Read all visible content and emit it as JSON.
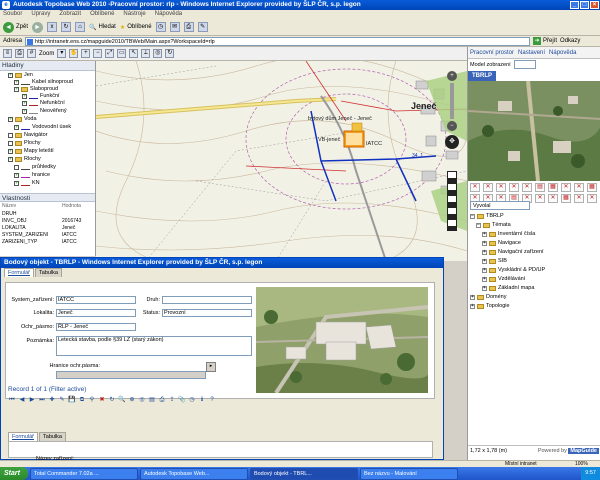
{
  "window": {
    "title": "Autodesk Topobase Web 2010 -Pracovní prostor: rlp - Windows Internet Explorer provided by ŠLP ČR, s.p. legon"
  },
  "menu": [
    "Soubor",
    "Úpravy",
    "Zobrazit",
    "Oblíbené",
    "Nástroje",
    "Nápověda"
  ],
  "toolbar": {
    "back": "Zpět",
    "search": "Hledat",
    "favorites": "Oblíbené"
  },
  "address": {
    "label": "Adresa",
    "url": "http://intranetr.ens.cz/mapguide2010/TBWeb/Main.aspx?WorkspaceId=rlp",
    "go": "Přejít",
    "links": "Odkazy"
  },
  "app_toolbar": {
    "zoom_label": "Zoom"
  },
  "layers": {
    "title": "Hladiny",
    "items": [
      "Jen",
      "Kabel silnoproud",
      "Slaboproud",
      "Funkční",
      "Nefunkční",
      "Neověřený",
      "Voda",
      "Vodovodní úsek",
      "Navigátor",
      "Plochy",
      "Mapy leteští",
      "Rlochy",
      "průhledky",
      "hranice",
      "KN"
    ]
  },
  "properties": {
    "title": "Vlastnosti",
    "col_name": "Název",
    "col_value": "Hodnota",
    "rows": [
      {
        "k": "DRUH",
        "v": ""
      },
      {
        "k": "INVC_OBJ",
        "v": "2016743"
      },
      {
        "k": "LOKALITA",
        "v": "Jeneč"
      },
      {
        "k": "SYSTEM_ZARIZENI",
        "v": "IATCC"
      },
      {
        "k": "ZARIZENI_TYP",
        "v": "IATCC"
      }
    ]
  },
  "map": {
    "place_label": "Jeneč",
    "label_1": "bytový dům Jeneč - Jeneč",
    "label_2": "VB-jeneč",
    "label_3": "IATCC",
    "label_4": "34_1"
  },
  "right_panel": {
    "tabs": [
      "Pracovní prostor",
      "Nastavení",
      "Nápověda"
    ],
    "model_label": "Model zobrazení",
    "tbrlp_tab": "TBRLP",
    "dropdown": "Vyvolal",
    "tree": [
      "TBRLP",
      "Témata",
      "Inventární čísla",
      "Navigace",
      "Navigační zařízení",
      "SIB",
      "Vyskládní & PD/UP",
      "Vzdělávání",
      "Základní mapa",
      "Domény",
      "Topologie"
    ],
    "coords": "1,72 x 1,78 (m)",
    "powered": "Powered by",
    "mapguide": "MapGuide"
  },
  "popup": {
    "title": "Bodový objekt - TBRLP - Windows Internet Explorer provided by ŠLP ČR, s.p. legon",
    "tabs": [
      "Formulář",
      "Tabulka"
    ],
    "fields": {
      "system_label": "System_zařízení:",
      "system_value": "IATCC",
      "druh_label": "Druh:",
      "druh_value": "",
      "lokalita_label": "Lokalita:",
      "lokalita_value": "Jeneč",
      "status_label": "Status:",
      "status_value": "Provozní",
      "ochr_label": "Ochr_pásmo:",
      "ochr_value": "ŘLP - Jeneč",
      "poznamka_label": "Poznámka:",
      "poznamka_value": "Letecká stavba, podle §39 LZ (starý zákon)",
      "hranice_label": "Hranice ochr.pásma:"
    },
    "record_text": "Record 1 of 1  (Filter active)",
    "nazev_label": "Název zařízení:"
  },
  "statusbar": {
    "zone": "Místní intranet",
    "zoom": "100%"
  },
  "taskbar": {
    "start": "Start",
    "tasks": [
      "Total Commander 7.02a ...",
      "Autodesk Topobase Web...",
      "Bodový objekt - TBRL...",
      "Bez názvu - Malování"
    ],
    "clock": "9:57"
  }
}
